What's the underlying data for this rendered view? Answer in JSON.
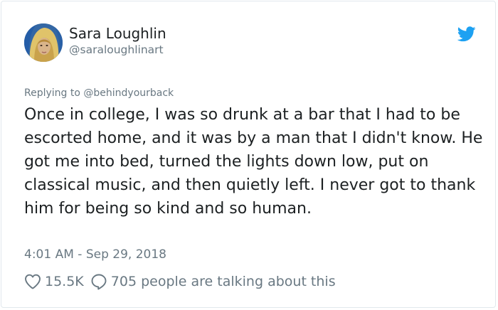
{
  "author": {
    "name": "Sara Loughlin",
    "handle": "@saraloughlinart"
  },
  "icons": {
    "avatar": "profile-photo",
    "logo": "twitter-bird-icon",
    "like": "heart-icon",
    "reply": "speech-bubble-icon"
  },
  "colors": {
    "brand": "#1da1f2",
    "text": "#1c2022",
    "muted": "#697882",
    "border": "#e1e8ed"
  },
  "tweet": {
    "reply_prefix": "Replying to ",
    "reply_to": "@behindyourback",
    "text": "Once in college, I was so drunk at a bar that I had to be escorted home, and it was by a man that I didn't know. He got me into bed, turned the lights down low, put on classical music, and then quietly left. I never got to thank him for being so kind and so human.",
    "timestamp": "4:01 AM - Sep 29, 2018"
  },
  "stats": {
    "likes": "15.5K",
    "talking": "705 people are talking about this"
  }
}
